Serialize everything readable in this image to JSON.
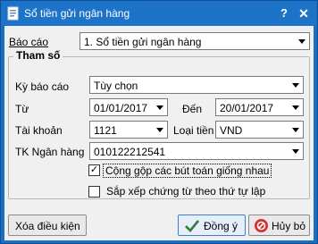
{
  "window": {
    "title": "Sổ tiền gửi ngân hàng",
    "help_label": "?",
    "close_label": "✕"
  },
  "report": {
    "label": "Báo cáo",
    "value": "1. Sổ tiền gửi ngân hàng"
  },
  "params": {
    "legend": "Tham số",
    "period_label": "Kỳ báo cáo",
    "period_value": "Tùy chọn",
    "from_label": "Từ",
    "from_value": "01/01/2017",
    "to_label": "Đến",
    "to_value": "20/01/2017",
    "account_label": "Tài khoản",
    "account_value": "1121",
    "currency_label": "Loại tiền",
    "currency_value": "VND",
    "bank_account_label": "TK Ngân hàng",
    "bank_account_value": "010122212541",
    "merge_label": "Cộng gộp các bút toán giống nhau",
    "merge_checked": true,
    "sort_label": "Sắp xếp chứng từ theo thứ tự lập",
    "sort_checked": false
  },
  "buttons": {
    "clear_label": "Xóa điều kiện",
    "ok_label": "Đồng ý",
    "cancel_label": "Hủy bỏ"
  },
  "colors": {
    "titlebar": "#1d73c8",
    "ok_icon": "#2e7d32",
    "cancel_icon": "#d32f2f"
  }
}
